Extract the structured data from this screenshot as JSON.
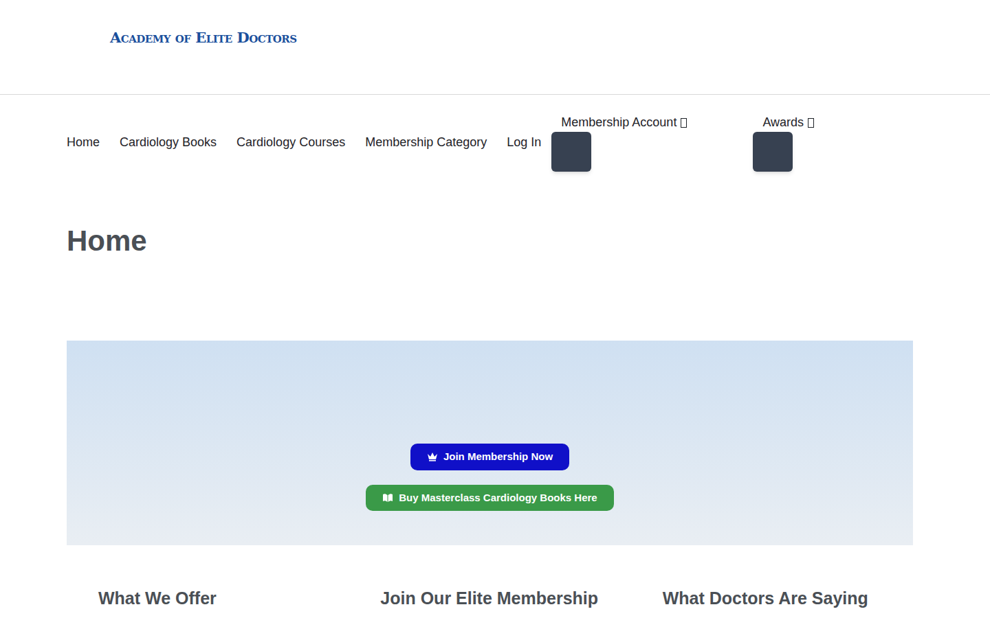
{
  "logo": "Academy of Elite Doctors",
  "nav": {
    "items": [
      {
        "label": "Home"
      },
      {
        "label": "Cardiology Books"
      },
      {
        "label": "Cardiology Courses"
      },
      {
        "label": "Membership Category"
      },
      {
        "label": "Log In"
      }
    ],
    "dropdowns": [
      {
        "label": "Membership Account"
      },
      {
        "label": "Awards"
      }
    ]
  },
  "page_title": "Home",
  "hero": {
    "buttons": [
      {
        "label": "Join Membership Now",
        "kind": "crown",
        "color": "#1010c8"
      },
      {
        "label": "Buy Masterclass Cardiology Books Here",
        "kind": "book",
        "color": "#3a9a48"
      }
    ]
  },
  "sections": [
    {
      "title": "What We Offer"
    },
    {
      "title": "Join Our Elite Membership"
    },
    {
      "title": "What Doctors Are Saying"
    }
  ]
}
